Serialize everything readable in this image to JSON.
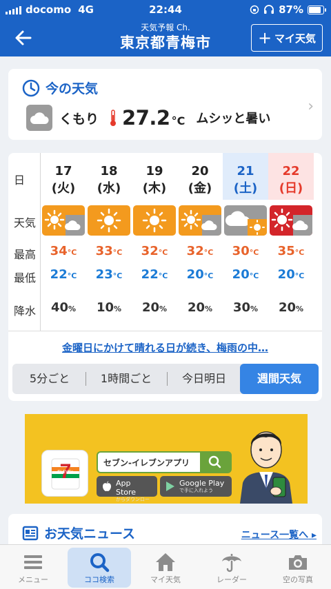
{
  "status_bar": {
    "carrier": "docomo",
    "network": "4G",
    "time": "22:44",
    "battery": "87%"
  },
  "header": {
    "subtitle": "天気予報 Ch.",
    "title": "東京都青梅市",
    "my_weather_button": "マイ天気"
  },
  "current": {
    "heading": "今の天気",
    "condition": "くもり",
    "temperature": "27.2",
    "unit": "°C",
    "feeling": "ムシッと暑い"
  },
  "week": {
    "row_labels": {
      "day": "日",
      "weather": "天気",
      "high": "最高",
      "low": "最低",
      "precip": "降水"
    },
    "days": [
      {
        "date": "17",
        "dow": "(火)",
        "icon": "sun-cloud-icon",
        "high": "34",
        "low": "22",
        "precip": "40"
      },
      {
        "date": "18",
        "dow": "(水)",
        "icon": "sun-icon",
        "high": "33",
        "low": "23",
        "precip": "10"
      },
      {
        "date": "19",
        "dow": "(木)",
        "icon": "sun-icon",
        "high": "32",
        "low": "22",
        "precip": "20"
      },
      {
        "date": "20",
        "dow": "(金)",
        "icon": "sun-cloud-icon",
        "high": "32",
        "low": "20",
        "precip": "20"
      },
      {
        "date": "21",
        "dow": "(土)",
        "icon": "cloud-sun-icon",
        "high": "30",
        "low": "20",
        "precip": "30"
      },
      {
        "date": "22",
        "dow": "(日)",
        "icon": "hot-sun-cloud-icon",
        "high": "35",
        "low": "20",
        "precip": "20"
      }
    ],
    "temp_unit": "°C",
    "precip_unit": "%",
    "link_text": "金曜日にかけて晴れる日が続き、梅雨の中…",
    "segments": [
      "5分ごと",
      "1時間ごと",
      "今日明日",
      "週間天気"
    ],
    "active_segment": "週間天気"
  },
  "ad": {
    "logo_text": "7",
    "logo_sub": "ELEVEn",
    "search_text": "セブン-イレブンアプリ",
    "app_store": "App Store",
    "app_store_sub": "からダウンロード",
    "google_play": "Google Play",
    "google_play_sub": "で手に入れよう"
  },
  "news": {
    "heading": "お天気ニュース",
    "link": "ニュース一覧へ"
  },
  "tabs": [
    {
      "label": "メニュー",
      "icon": "menu-icon"
    },
    {
      "label": "ココ検索",
      "icon": "search-icon"
    },
    {
      "label": "マイ天気",
      "icon": "home-icon"
    },
    {
      "label": "レーダー",
      "icon": "umbrella-icon"
    },
    {
      "label": "空の写真",
      "icon": "camera-icon"
    }
  ],
  "active_tab": "ココ検索",
  "colors": {
    "brand": "#1b63c6",
    "high": "#e8632b",
    "low": "#1b7bd6",
    "sun_bg": "#f39a1e",
    "cloud_bg": "#9b9b9b",
    "hot_bg": "#d3252a"
  }
}
